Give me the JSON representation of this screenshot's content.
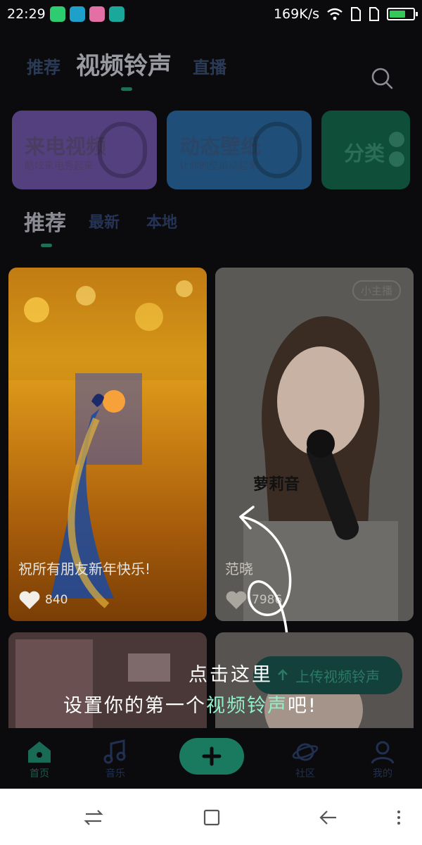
{
  "status": {
    "time": "22:29",
    "speed": "169K/s",
    "battery_level": 0.7
  },
  "top_tabs": [
    {
      "label": "推荐"
    },
    {
      "label": "视频铃声"
    },
    {
      "label": "直播"
    }
  ],
  "features": [
    {
      "title": "来电视频",
      "subtitle": "酷炫来电秀起来",
      "color": "#5b3f86"
    },
    {
      "title": "动态壁纸",
      "subtitle": "让你的壁纸动起来",
      "color": "#1f4d73"
    },
    {
      "title": "分类",
      "color": "#0f4a36"
    }
  ],
  "sub_tabs": [
    {
      "label": "推荐"
    },
    {
      "label": "最新"
    },
    {
      "label": "本地"
    }
  ],
  "cards": [
    {
      "caption": "祝所有朋友新年快乐!",
      "likes": "840"
    },
    {
      "caption": "范晓",
      "likes": "7986",
      "tag": "小主播",
      "overlay_text": "萝莉音"
    }
  ],
  "upload_label": "上传视频铃声",
  "guide": {
    "line1": "点击这里",
    "line2_prefix": "设置你的第一个",
    "line2_highlight": "视频铃声",
    "line2_suffix": "吧!"
  },
  "bottom_nav": [
    {
      "label": "首页",
      "icon": "home-icon"
    },
    {
      "label": "音乐",
      "icon": "music-note-icon"
    },
    {
      "label": "社区",
      "icon": "planet-icon"
    },
    {
      "label": "我的",
      "icon": "profile-icon"
    }
  ],
  "add_button": {
    "icon": "plus-icon"
  },
  "system_nav": [
    "switch-apps-icon",
    "home-square-icon",
    "back-icon",
    "menu-icon"
  ]
}
